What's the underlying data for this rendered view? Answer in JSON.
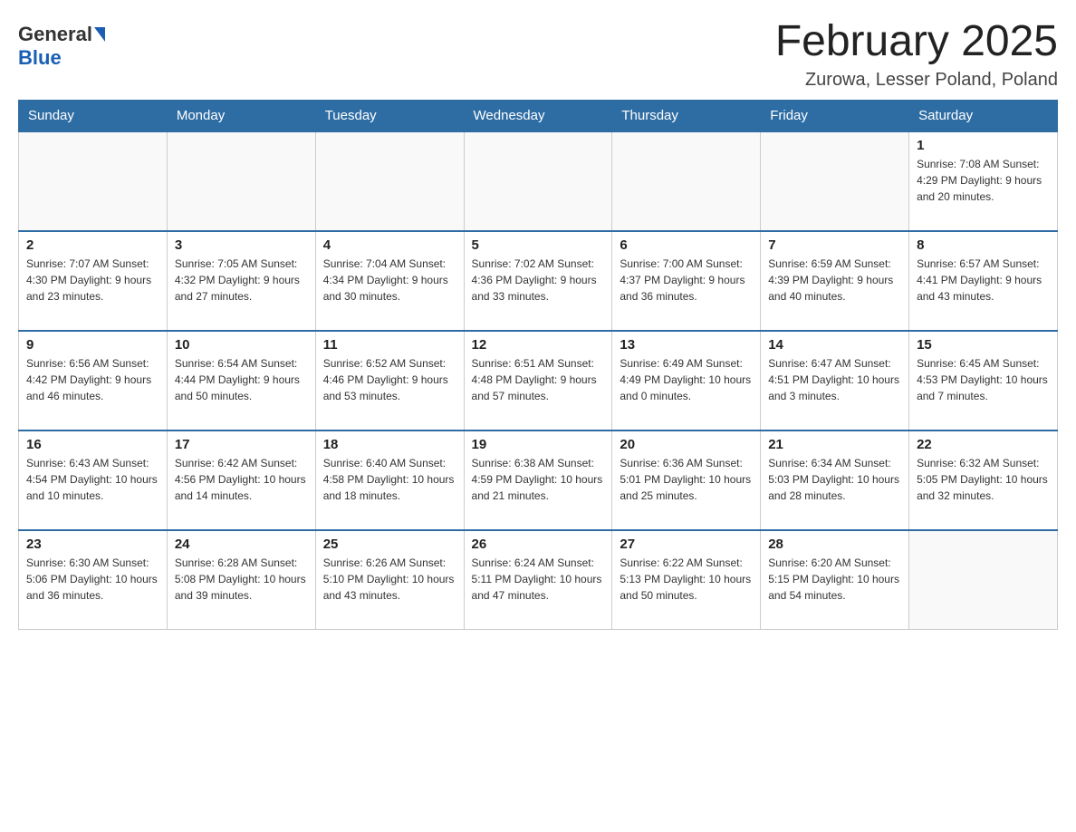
{
  "header": {
    "logo": {
      "general": "General",
      "blue": "Blue"
    },
    "title": "February 2025",
    "location": "Zurowa, Lesser Poland, Poland"
  },
  "weekdays": [
    "Sunday",
    "Monday",
    "Tuesday",
    "Wednesday",
    "Thursday",
    "Friday",
    "Saturday"
  ],
  "weeks": [
    [
      {
        "day": "",
        "info": ""
      },
      {
        "day": "",
        "info": ""
      },
      {
        "day": "",
        "info": ""
      },
      {
        "day": "",
        "info": ""
      },
      {
        "day": "",
        "info": ""
      },
      {
        "day": "",
        "info": ""
      },
      {
        "day": "1",
        "info": "Sunrise: 7:08 AM\nSunset: 4:29 PM\nDaylight: 9 hours\nand 20 minutes."
      }
    ],
    [
      {
        "day": "2",
        "info": "Sunrise: 7:07 AM\nSunset: 4:30 PM\nDaylight: 9 hours\nand 23 minutes."
      },
      {
        "day": "3",
        "info": "Sunrise: 7:05 AM\nSunset: 4:32 PM\nDaylight: 9 hours\nand 27 minutes."
      },
      {
        "day": "4",
        "info": "Sunrise: 7:04 AM\nSunset: 4:34 PM\nDaylight: 9 hours\nand 30 minutes."
      },
      {
        "day": "5",
        "info": "Sunrise: 7:02 AM\nSunset: 4:36 PM\nDaylight: 9 hours\nand 33 minutes."
      },
      {
        "day": "6",
        "info": "Sunrise: 7:00 AM\nSunset: 4:37 PM\nDaylight: 9 hours\nand 36 minutes."
      },
      {
        "day": "7",
        "info": "Sunrise: 6:59 AM\nSunset: 4:39 PM\nDaylight: 9 hours\nand 40 minutes."
      },
      {
        "day": "8",
        "info": "Sunrise: 6:57 AM\nSunset: 4:41 PM\nDaylight: 9 hours\nand 43 minutes."
      }
    ],
    [
      {
        "day": "9",
        "info": "Sunrise: 6:56 AM\nSunset: 4:42 PM\nDaylight: 9 hours\nand 46 minutes."
      },
      {
        "day": "10",
        "info": "Sunrise: 6:54 AM\nSunset: 4:44 PM\nDaylight: 9 hours\nand 50 minutes."
      },
      {
        "day": "11",
        "info": "Sunrise: 6:52 AM\nSunset: 4:46 PM\nDaylight: 9 hours\nand 53 minutes."
      },
      {
        "day": "12",
        "info": "Sunrise: 6:51 AM\nSunset: 4:48 PM\nDaylight: 9 hours\nand 57 minutes."
      },
      {
        "day": "13",
        "info": "Sunrise: 6:49 AM\nSunset: 4:49 PM\nDaylight: 10 hours\nand 0 minutes."
      },
      {
        "day": "14",
        "info": "Sunrise: 6:47 AM\nSunset: 4:51 PM\nDaylight: 10 hours\nand 3 minutes."
      },
      {
        "day": "15",
        "info": "Sunrise: 6:45 AM\nSunset: 4:53 PM\nDaylight: 10 hours\nand 7 minutes."
      }
    ],
    [
      {
        "day": "16",
        "info": "Sunrise: 6:43 AM\nSunset: 4:54 PM\nDaylight: 10 hours\nand 10 minutes."
      },
      {
        "day": "17",
        "info": "Sunrise: 6:42 AM\nSunset: 4:56 PM\nDaylight: 10 hours\nand 14 minutes."
      },
      {
        "day": "18",
        "info": "Sunrise: 6:40 AM\nSunset: 4:58 PM\nDaylight: 10 hours\nand 18 minutes."
      },
      {
        "day": "19",
        "info": "Sunrise: 6:38 AM\nSunset: 4:59 PM\nDaylight: 10 hours\nand 21 minutes."
      },
      {
        "day": "20",
        "info": "Sunrise: 6:36 AM\nSunset: 5:01 PM\nDaylight: 10 hours\nand 25 minutes."
      },
      {
        "day": "21",
        "info": "Sunrise: 6:34 AM\nSunset: 5:03 PM\nDaylight: 10 hours\nand 28 minutes."
      },
      {
        "day": "22",
        "info": "Sunrise: 6:32 AM\nSunset: 5:05 PM\nDaylight: 10 hours\nand 32 minutes."
      }
    ],
    [
      {
        "day": "23",
        "info": "Sunrise: 6:30 AM\nSunset: 5:06 PM\nDaylight: 10 hours\nand 36 minutes."
      },
      {
        "day": "24",
        "info": "Sunrise: 6:28 AM\nSunset: 5:08 PM\nDaylight: 10 hours\nand 39 minutes."
      },
      {
        "day": "25",
        "info": "Sunrise: 6:26 AM\nSunset: 5:10 PM\nDaylight: 10 hours\nand 43 minutes."
      },
      {
        "day": "26",
        "info": "Sunrise: 6:24 AM\nSunset: 5:11 PM\nDaylight: 10 hours\nand 47 minutes."
      },
      {
        "day": "27",
        "info": "Sunrise: 6:22 AM\nSunset: 5:13 PM\nDaylight: 10 hours\nand 50 minutes."
      },
      {
        "day": "28",
        "info": "Sunrise: 6:20 AM\nSunset: 5:15 PM\nDaylight: 10 hours\nand 54 minutes."
      },
      {
        "day": "",
        "info": ""
      }
    ]
  ]
}
